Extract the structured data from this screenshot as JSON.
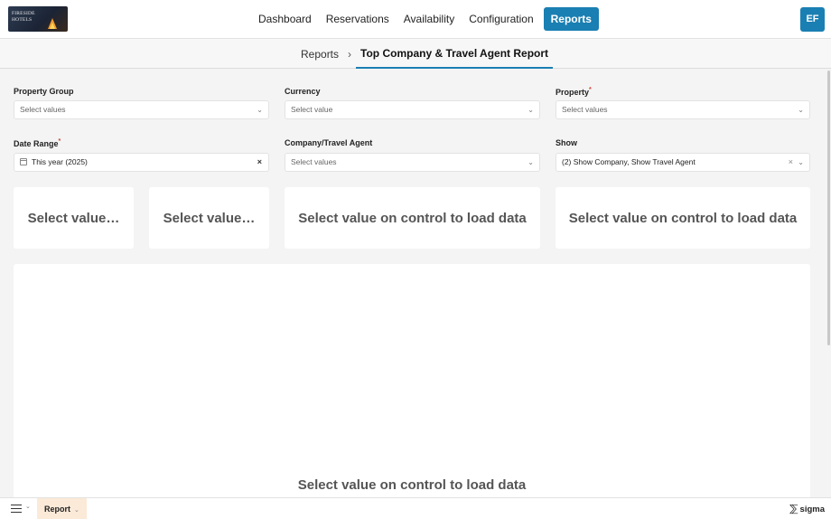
{
  "nav": {
    "logo_text": [
      "FIRESIDE",
      "HOTELS"
    ],
    "items": [
      "Dashboard",
      "Reservations",
      "Availability",
      "Configuration",
      "Reports"
    ],
    "active": "Reports",
    "user_initials": "EF"
  },
  "breadcrumb": {
    "parent": "Reports",
    "separator": "›",
    "current": "Top Company & Travel Agent Report"
  },
  "filters": {
    "property_group": {
      "label": "Property Group",
      "placeholder": "Select values"
    },
    "currency": {
      "label": "Currency",
      "placeholder": "Select value"
    },
    "property": {
      "label": "Property",
      "required": "*",
      "placeholder": "Select values"
    },
    "date_range": {
      "label": "Date Range",
      "required": "*",
      "value": "This year (2025)",
      "clear": "×"
    },
    "company_travel_agent": {
      "label": "Company/Travel Agent",
      "placeholder": "Select values"
    },
    "show": {
      "label": "Show",
      "value": "(2) Show Company, Show Travel Agent",
      "clear": "×"
    }
  },
  "cards": {
    "card1": "Select value…",
    "card2": "Select value…",
    "card3": "Select value on control to load data",
    "card4": "Select value on control to load data",
    "main": "Select value on control to load data"
  },
  "bottom": {
    "page_tab": "Report",
    "brand": "sigma"
  },
  "colors": {
    "accent": "#1a7fb2",
    "page_tab_bg": "#fbead8"
  }
}
